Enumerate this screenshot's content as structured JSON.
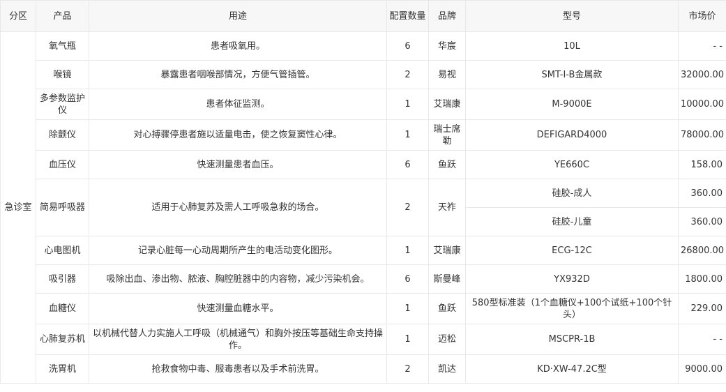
{
  "headers": {
    "zone": "分区",
    "product": "产品",
    "usage": "用途",
    "qty": "配置数量",
    "brand": "品牌",
    "model": "型号",
    "price": "市场价"
  },
  "zone": "急诊室",
  "rows": [
    {
      "product": "氧气瓶",
      "usage": "患者吸氧用。",
      "qty": "6",
      "brand": "华宸",
      "model": "10L",
      "price": "- -"
    },
    {
      "product": "喉镜",
      "usage": "暴露患者咽喉部情况，方便气管插管。",
      "qty": "2",
      "brand": "易视",
      "model": "SMT-I-B金属款",
      "price": "32000.00"
    },
    {
      "product": "多参数监护仪",
      "usage": "患者体征监测。",
      "qty": "1",
      "brand": "艾瑞康",
      "model": "M-9000E",
      "price": "10000.00"
    },
    {
      "product": "除颤仪",
      "usage": "对心搏骤停患者施以适量电击，使之恢复窦性心律。",
      "qty": "1",
      "brand": "瑞士席勒",
      "model": "DEFIGARD4000",
      "price": "78000.00"
    },
    {
      "product": "血压仪",
      "usage": "快速测量患者血压。",
      "qty": "6",
      "brand": "鱼跃",
      "model": "YE660C",
      "price": "158.00"
    },
    {
      "product": "简易呼吸器",
      "usage": "适用于心肺复苏及需人工呼吸急救的场合。",
      "qty": "2",
      "brand": "天祚",
      "model": "硅胶-成人",
      "price": "360.00",
      "model2": "硅胶-儿童",
      "price2": "360.00"
    },
    {
      "product": "心电图机",
      "usage": "记录心脏每一心动周期所产生的电活动变化图形。",
      "qty": "1",
      "brand": "艾瑞康",
      "model": "ECG-12C",
      "price": "26800.00"
    },
    {
      "product": "吸引器",
      "usage": "吸除出血、渗出物、脓液、胸腔脏器中的内容物，减少污染机会。",
      "qty": "6",
      "brand": "斯曼峰",
      "model": "YX932D",
      "price": "1800.00"
    },
    {
      "product": "血糖仪",
      "usage": "快速测量血糖水平。",
      "qty": "1",
      "brand": "鱼跃",
      "model": "580型标准装（1个血糖仪+100个试纸+100个针头）",
      "price": "229.00"
    },
    {
      "product": "心肺复苏机",
      "usage": "以机械代替人力实施人工呼吸（机械通气）和胸外按压等基础生命支持操作。",
      "qty": "1",
      "brand": "迈松",
      "model": "MSCPR-1B",
      "price": "- -"
    },
    {
      "product": "洗胃机",
      "usage": "抢救食物中毒、服毒患者以及手术前洗胃。",
      "qty": "2",
      "brand": "凯达",
      "model": "KD·XW-47.2C型",
      "price": "9000.00"
    }
  ]
}
